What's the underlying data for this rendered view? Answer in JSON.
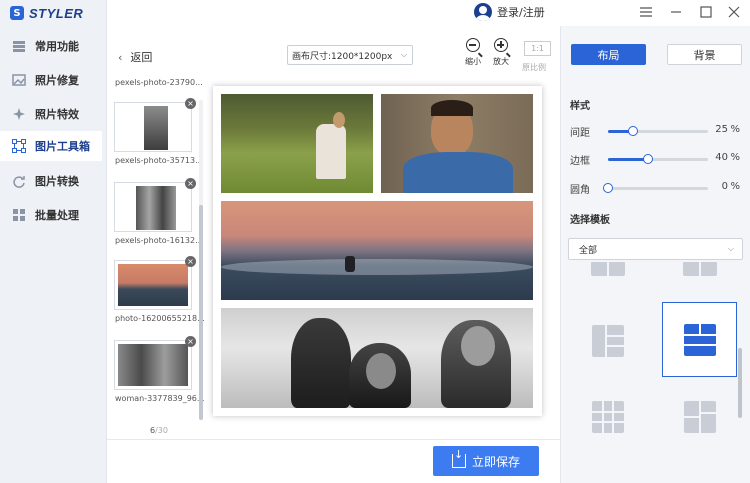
{
  "app": {
    "logo_letter": "S",
    "name": "STYLER"
  },
  "titlebar": {
    "user_label": "登录/注册"
  },
  "sidebar": {
    "items": [
      {
        "label": "常用功能",
        "icon": "layers-icon",
        "active": false
      },
      {
        "label": "照片修复",
        "icon": "photo-restore-icon",
        "active": false
      },
      {
        "label": "照片特效",
        "icon": "sparkle-icon",
        "active": false
      },
      {
        "label": "图片工具箱",
        "icon": "toolbox-icon",
        "active": true
      },
      {
        "label": "图片转换",
        "icon": "convert-icon",
        "active": false
      },
      {
        "label": "批量处理",
        "icon": "batch-icon",
        "active": false
      }
    ]
  },
  "thumbs": {
    "back_label": "返回",
    "items": [
      {
        "label": "pexels-photo-23790..."
      },
      {
        "label": "pexels-photo-35713..."
      },
      {
        "label": "pexels-photo-16132..."
      },
      {
        "label": "photo-16200655218..."
      },
      {
        "label": "woman-3377839_96..."
      }
    ],
    "page_current": "6",
    "page_total": "/30"
  },
  "toolbar": {
    "canvas_size": "画布尺寸:1200*1200px",
    "zoom_out_label": "缩小",
    "zoom_in_label": "放大",
    "ratio_btn": "1:1",
    "ratio_label": "原比例"
  },
  "save_button": "立即保存",
  "right_panel": {
    "tab_layout": "布局",
    "tab_background": "背景",
    "style_title": "样式",
    "sliders": [
      {
        "label": "间距",
        "value": "25",
        "unit": "%",
        "level": 0.25
      },
      {
        "label": "边框",
        "value": "40",
        "unit": "%",
        "level": 0.4
      },
      {
        "label": "圆角",
        "value": "0",
        "unit": "%",
        "level": 0.0
      }
    ],
    "template_title": "选择模板",
    "template_filter": "全部"
  },
  "colors": {
    "accent": "#2a64d6",
    "save": "#3d7bf0",
    "sidebar_bg": "#eef1f6",
    "panel_bg": "#f4f5f8"
  }
}
